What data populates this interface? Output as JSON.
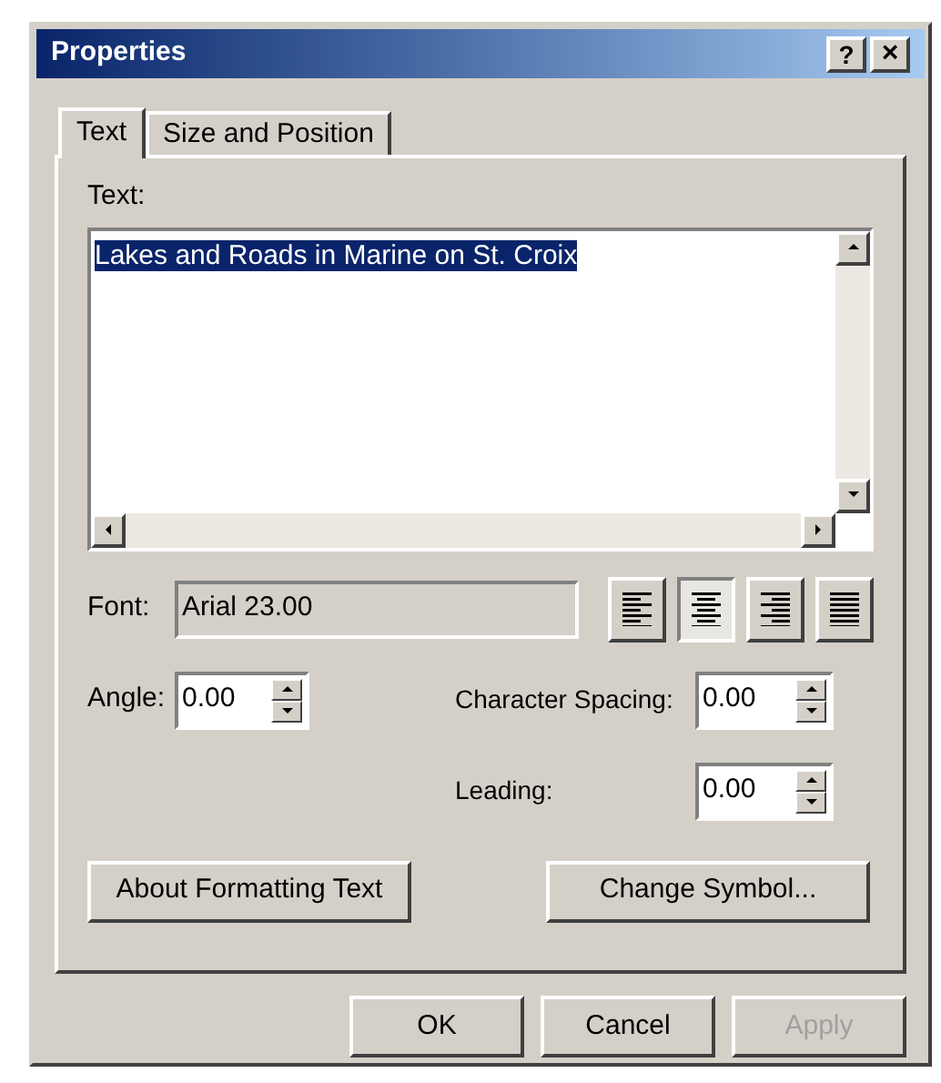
{
  "window": {
    "title": "Properties",
    "help_button": "?",
    "close_button": "×"
  },
  "tabs": [
    {
      "label": "Text",
      "selected": true
    },
    {
      "label": "Size and Position",
      "selected": false
    }
  ],
  "text_label": "Text:",
  "text_value": "Lakes and Roads in Marine on St. Croix",
  "text_selected": true,
  "font_label": "Font:",
  "font_value": "Arial 23.00",
  "alignment": [
    {
      "kind": "left",
      "selected": false
    },
    {
      "kind": "center",
      "selected": true
    },
    {
      "kind": "right",
      "selected": false
    },
    {
      "kind": "justify",
      "selected": false
    }
  ],
  "angle": {
    "label": "Angle:",
    "value": "0.00"
  },
  "character_spacing": {
    "label": "Character Spacing:",
    "value": "0.00"
  },
  "leading": {
    "label": "Leading:",
    "value": "0.00"
  },
  "panel_buttons": [
    "About Formatting Text",
    "Change Symbol..."
  ],
  "dialog_buttons": [
    {
      "label": "OK",
      "disabled": false
    },
    {
      "label": "Cancel",
      "disabled": false
    },
    {
      "label": "Apply",
      "disabled": true
    }
  ]
}
